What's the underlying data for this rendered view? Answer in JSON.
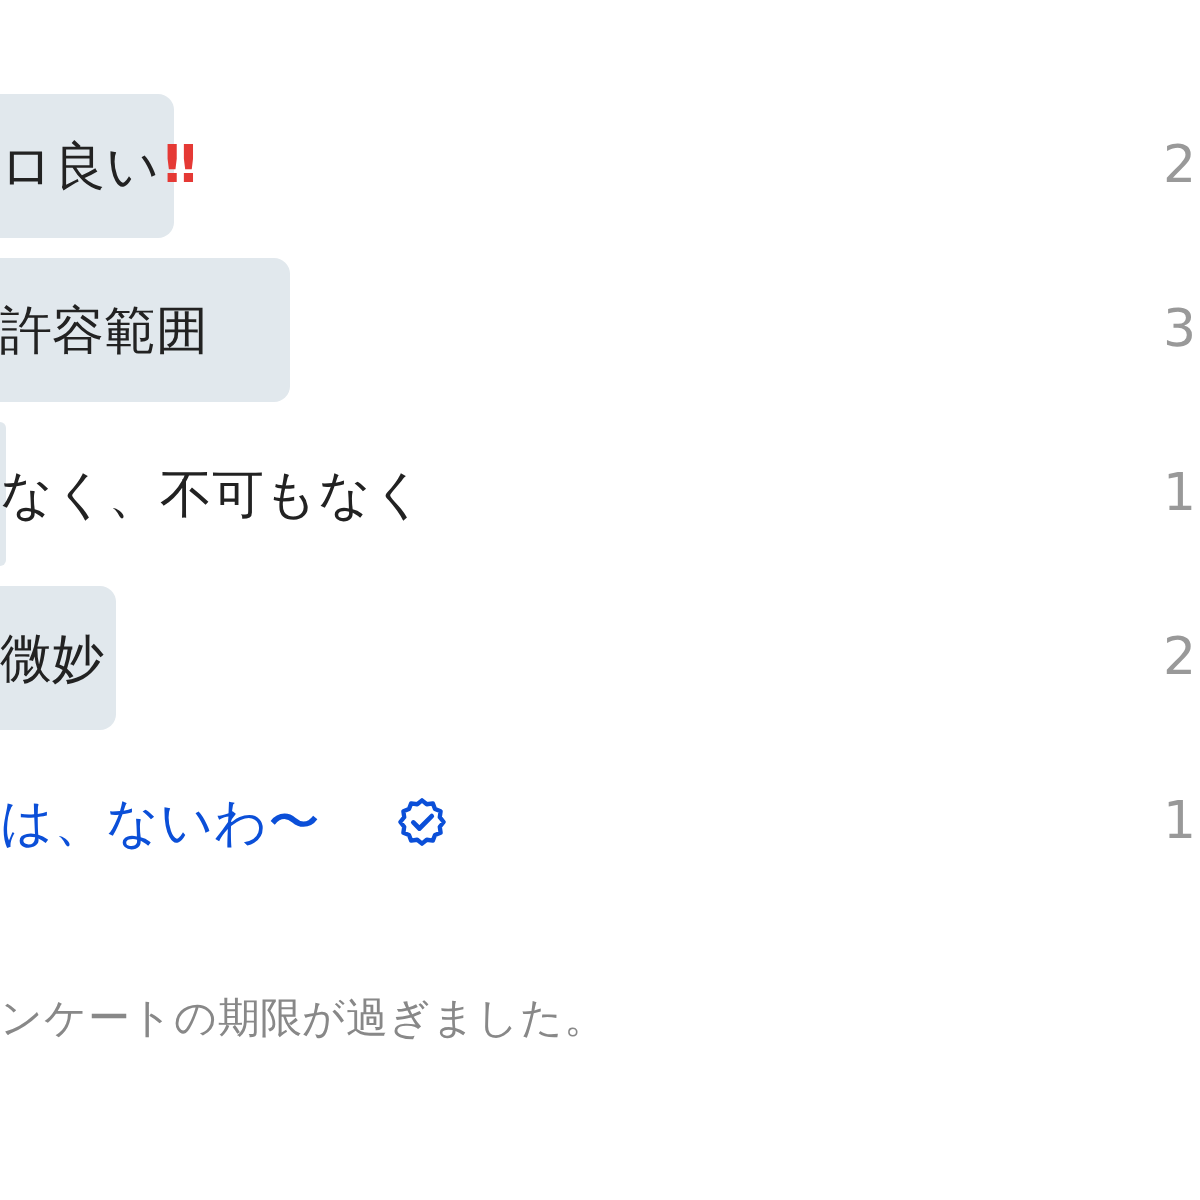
{
  "poll": {
    "options": [
      {
        "label": "ロ良い",
        "emoji": "‼",
        "level": 0.15,
        "count": "2",
        "leading": false,
        "voted": false
      },
      {
        "label": "許容範囲",
        "level": 0.25,
        "count": "3",
        "leading": false,
        "voted": false
      },
      {
        "label": "なく、不可もなく",
        "level": 0.005,
        "count": "1",
        "leading": false,
        "voted": false
      },
      {
        "label": "微妙",
        "level": 0.1,
        "count": "2",
        "leading": false,
        "voted": false
      },
      {
        "label": "は、ないわ〜",
        "count": "1",
        "leading": true,
        "voted": true
      }
    ],
    "status": "ンケートの期限が過ぎました。"
  }
}
